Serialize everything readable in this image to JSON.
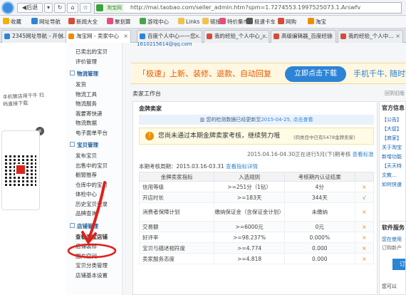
{
  "browser": {
    "back_label": "后退",
    "url_site": "淘宝网",
    "url": "http://mai.taobao.com/seller_admin.htm?spm=1.7274553.1997525073.1.Arswfv"
  },
  "bookmarks": [
    {
      "label": "收藏",
      "color": "#f2b200"
    },
    {
      "label": "网址导航",
      "color": "#2c84d6"
    },
    {
      "label": "新闻大全",
      "color": "#d84a3a"
    },
    {
      "label": "聚划算",
      "color": "#e94b7a"
    },
    {
      "label": "游戏中心",
      "color": "#46a548"
    },
    {
      "label": "Links",
      "color": "#f2c14e"
    },
    {
      "label": "链接",
      "color": "#f2c14e"
    },
    {
      "label": "特价集市",
      "color": "#e94b7a"
    },
    {
      "label": "极速卡车",
      "color": "#555"
    },
    {
      "label": "网购",
      "color": "#d84a3a"
    },
    {
      "label": "淘宝",
      "color": "#f08c00"
    }
  ],
  "tabs": [
    {
      "label": "2345网址导航 - 开创…",
      "color": "#2c84d6",
      "active": false
    },
    {
      "label": "淘宝网 - 卖家中心",
      "color": "#f08c00",
      "active": true
    },
    {
      "label": "百度个人中心——您…",
      "color": "#2c84d6",
      "active": false
    },
    {
      "label": "我的经验_个人中心_…",
      "color": "#d84a3a",
      "active": false
    },
    {
      "label": "高级编辑器_百度经验",
      "color": "#d84a3a",
      "active": false
    },
    {
      "label": "我的经验_个人中…",
      "color": "#d84a3a",
      "active": false
    }
  ],
  "left_popup": {
    "text": "手机管店用千牛 扫码直接下载",
    "close": "×"
  },
  "sidebar": {
    "top_items": [
      "已卖出的宝贝",
      "评价管理"
    ],
    "logistics_head": "物流管理",
    "logistics_items": [
      "发货",
      "物流工具",
      "物流服务",
      "我要寄快递",
      "物流数据",
      "电子面单平台"
    ],
    "goods_head": "宝贝管理",
    "goods_items": [
      "发布宝贝",
      "出售中的宝贝",
      "橱窗推荐",
      "仓库中的宝贝",
      "体检中心",
      "历史宝贝记录",
      "品牌查询"
    ],
    "store_head": "店铺管理",
    "store_items": [
      "查看淘宝店铺",
      "店铺装修",
      "图片空间",
      "宝贝分类管理",
      "店铺基本设置"
    ]
  },
  "main": {
    "email": "1610215614@qq.com",
    "banner_text": "「极速」上新、装修、退款、自动回复",
    "banner_button": "立即点击下载",
    "banner_right": "手机千牛, 随时随",
    "workbench_title": "卖家工作台",
    "old_version": "回到旧版",
    "panel_title": "金牌卖家",
    "alert_text": "您的检测数据已经更新至",
    "alert_date": "2015-04-25,",
    "alert_link": "点击查看",
    "warn_text": "您尚未通过本期金牌卖家考核，继续努力哦",
    "warn_sub": "(同类目中已有5478金牌卖家)",
    "period_text": "2015.04.16-04.30正在进行5月(下)期考核",
    "period_link": "查看标准",
    "cycle_label": "本期考核周期：",
    "cycle_value": "2015.03.16-03.31",
    "cycle_link": "查看指标详情"
  },
  "table": {
    "headers": [
      "金牌卖家指标",
      "入选规则",
      "考核期内认证结果",
      ""
    ],
    "rows": [
      [
        "信用等级",
        ">=251分（1钻）",
        "4分",
        "×"
      ],
      [
        "开店时长",
        ">=183天",
        "344天",
        "√"
      ],
      [
        "消费者保障计划",
        "缴纳保证金（含保证金计划）",
        "未缴纳",
        "×"
      ],
      [
        "交易额",
        ">=6000元",
        "0元",
        "×"
      ],
      [
        "好评率",
        ">=98.237%",
        "0.000%",
        "×"
      ],
      [
        "宝贝与描述相符度",
        ">=4.774",
        "0.000",
        "×"
      ],
      [
        "卖家服务态度",
        ">=4.818",
        "0.000",
        "×"
      ]
    ]
  },
  "right": {
    "title": "官方信息",
    "news": [
      "【公告】",
      "【大促】",
      "【商家】",
      "关于淘宝",
      "新增功能",
      "【天天特",
      "文教…",
      "如何快速"
    ],
    "soft_title": "软件服务",
    "soft_1": "您在使用",
    "soft_2": "订购新产",
    "soft_btn": "订",
    "soft_3": "您可以"
  }
}
